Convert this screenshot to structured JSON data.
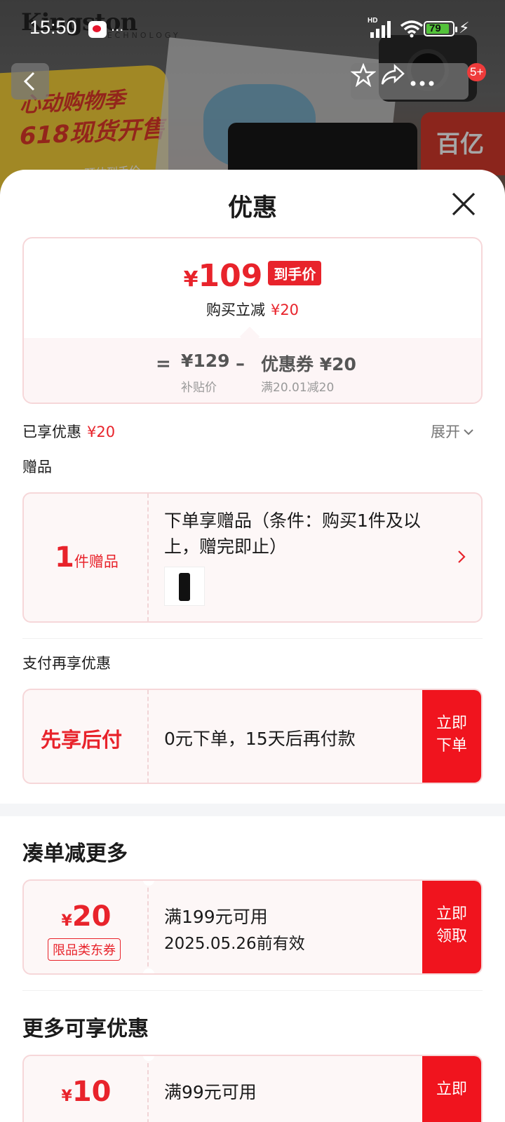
{
  "status_bar": {
    "time": "15:50",
    "dots": "...",
    "battery": "79"
  },
  "background": {
    "brand": "Kingston",
    "brand_sub": "TECHNOLOGY",
    "promo_line1": "心动购物季",
    "promo_line2": "618现货开售",
    "promo_line3": "预估到手价",
    "badge_text": "百亿",
    "notification_count": "5+"
  },
  "sheet": {
    "title": "优惠",
    "price": {
      "currency": "¥",
      "final": "109",
      "tag": "到手价",
      "save_label": "购买立减",
      "save_value": "¥20",
      "eq": "=",
      "minus": "–",
      "subsidy_value": "¥129",
      "subsidy_label": "补贴价",
      "coupon_value": "优惠券 ¥20",
      "coupon_label": "满20.01减20"
    },
    "enjoyed_label": "已享优惠",
    "enjoyed_value": "¥20",
    "expand_label": "展开",
    "gift_section": "赠品",
    "gift": {
      "count": "1",
      "count_unit": "件赠品",
      "desc": "下单享赠品（条件：购买1件及以上，赠完即止）"
    },
    "pay_section": "支付再享优惠",
    "pay": {
      "label": "先享后付",
      "desc": "0元下单，15天后再付款",
      "btn_line1": "立即",
      "btn_line2": "下单"
    },
    "bundle_section": "凑单减更多",
    "coupon1": {
      "currency": "¥",
      "value": "20",
      "tag": "限品类东券",
      "cond": "满199元可用",
      "valid": "2025.05.26前有效",
      "btn_line1": "立即",
      "btn_line2": "领取"
    },
    "more_section": "更多可享优惠",
    "coupon2": {
      "currency": "¥",
      "value": "10",
      "cond": "满99元可用",
      "btn_line1": "立即"
    }
  },
  "colors": {
    "accent": "#e8232b",
    "button_red": "#f0141e",
    "card_bg": "#fdf7f7",
    "card_border": "#f6d7d9"
  }
}
